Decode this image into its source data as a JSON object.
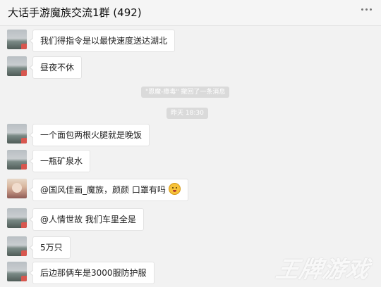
{
  "header": {
    "title": "大话手游魔族交流1群 (492)"
  },
  "messages": [
    {
      "text": "我们得指令是以最快速度送达湖北"
    },
    {
      "text": "昼夜不休"
    },
    {
      "text": "一个面包两根火腿就是晚饭"
    },
    {
      "text": "一瓶矿泉水"
    },
    {
      "text": "@国风佳画_魔族，颜颜 口罩有吗"
    },
    {
      "text": "@人情世故 我们车里全是"
    },
    {
      "text": "5万只"
    },
    {
      "text": "后边那俩车是3000服防护服"
    }
  ],
  "system": {
    "recall": "\"恩魔-瘴毒\" 撤回了一条消息",
    "timestamp": "昨天 18:30"
  },
  "watermark": "王牌游戏"
}
